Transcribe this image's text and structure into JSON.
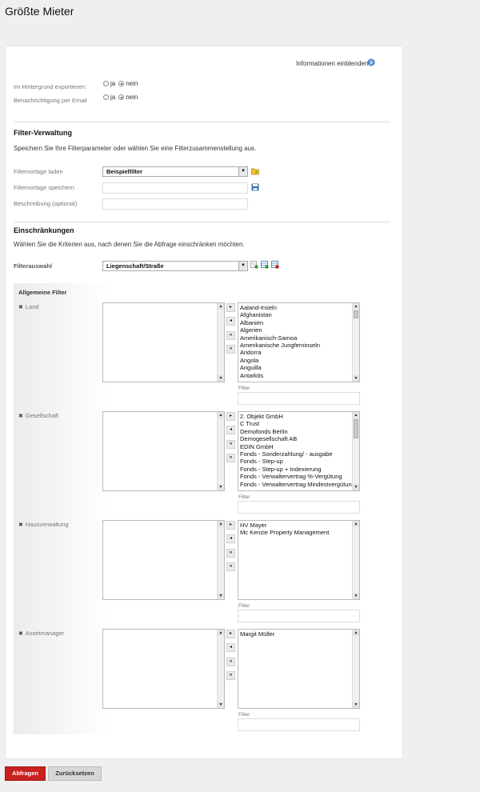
{
  "page": {
    "title": "Größte Mieter"
  },
  "info": {
    "label": "Informationen einblenden",
    "icon": "info-icon"
  },
  "background_export": {
    "label": "Im Hintergrund exportieren:",
    "yes": "ja",
    "no": "nein",
    "selected": "nein"
  },
  "email_notification": {
    "label": "Benachrichtigung per Email",
    "yes": "ja",
    "no": "nein",
    "selected": "nein"
  },
  "filter_admin": {
    "heading": "Filter-Verwaltung",
    "description": "Speichern Sie Ihre Filterparameter oder wählen Sie eine Filterzusammenstellung aus.",
    "load_label": "Filtervorlage laden",
    "load_value": "Beispielfilter",
    "save_label": "Filtervorlage speichern",
    "save_value": "",
    "desc_label": "Beschreibung (optional)",
    "desc_value": ""
  },
  "restrictions": {
    "heading": "Einschränkungen",
    "description": "Wählen Sie die Kriterien aus, nach denen Sie die Abfrage einschränken möchten.",
    "filter_select_label": "Filterauswahl",
    "filter_select_value": "Liegenschaft/Straße"
  },
  "filters": {
    "group_heading": "Allgemeine Filter",
    "filter_label": "Filter",
    "land": {
      "label": "Land",
      "selected": [],
      "available": [
        "Aaland-Inseln",
        "Afghanistan",
        "Albanien",
        "Algerien",
        "Amerikanisch-Samoa",
        "Amerikanische Jungferninseln",
        "Andorra",
        "Angola",
        "Anguilla",
        "Antarktis"
      ],
      "filter_value": ""
    },
    "gesellschaft": {
      "label": "Gesellschaft",
      "selected": [],
      "available": [
        "2. Objekt GmbH",
        "C Trust",
        "Demofonds Berlin",
        "Demogesellschaft AB",
        "EDIN GmbH",
        "Fonds - Sonderzahlung/ - ausgabe",
        "Fonds - Step-up",
        "Fonds - Step-up + Indexierung",
        "Fonds - Verwaltervertrag %-Vergütung",
        "Fonds - Verwaltervertrag Mindestvergütung"
      ],
      "filter_value": ""
    },
    "hausverwaltung": {
      "label": "Hausverwaltung",
      "selected": [],
      "available": [
        "HV Mayer",
        "Mc Kenzie Property Management"
      ],
      "filter_value": ""
    },
    "assetmanager": {
      "label": "Assetmanager",
      "selected": [],
      "available": [
        "Margit Müller"
      ],
      "filter_value": ""
    }
  },
  "buttons": {
    "submit": "Abfragen",
    "reset": "Zurücksetzen"
  },
  "colors": {
    "primary_button": "#c8201e",
    "secondary_button": "#d7d7d7",
    "accent_icon": "#3a78c4"
  }
}
